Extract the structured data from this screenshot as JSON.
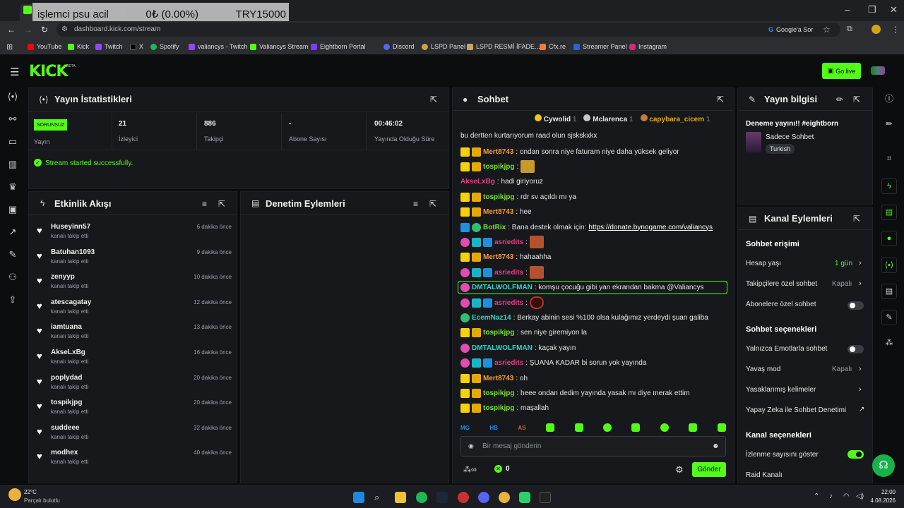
{
  "browser": {
    "ticker": {
      "title": "işlemci psu acil",
      "change": "0₺ (0.00%)",
      "amount": "TRY15000"
    },
    "url": "dashboard.kick.com/stream",
    "ask_google": "Google'a Sor",
    "bookmarks": [
      "YouTube",
      "Kick",
      "Twitch",
      "X",
      "Spotify",
      "valiancys - Twitch",
      "Valiancys Stream",
      "Eightborn Portal",
      "Discord",
      "LSPD Panel",
      "LSPD  RESMİ İFADE...",
      "Cfx.re",
      "Streamer Panel",
      "Instagram"
    ]
  },
  "header": {
    "logo": "KICK",
    "beta": "BETA",
    "go_live": "Go live"
  },
  "stats": {
    "title": "Yayın İstatistikleri",
    "badge": "SORUNSUZ",
    "stream_label": "Yayın",
    "viewers": "21",
    "viewers_label": "İzleyici",
    "followers": "886",
    "followers_label": "Takipçi",
    "subs": "-",
    "subs_label": "Abone Sayısı",
    "uptime": "00:46:02",
    "uptime_label": "Yayında Olduğu Süre",
    "status_msg": "Stream started successfully."
  },
  "activity": {
    "title": "Etkinlik Akışı",
    "items": [
      {
        "name": "Huseyinn57",
        "sub": "kanalı takip etti",
        "time": "6 dakika önce"
      },
      {
        "name": "Batuhan1093",
        "sub": "kanalı takip etti",
        "time": "9 dakika önce"
      },
      {
        "name": "zenyyp",
        "sub": "kanalı takip etti",
        "time": "10 dakika önce"
      },
      {
        "name": "atescagatay",
        "sub": "kanalı takip etti",
        "time": "12 dakika önce"
      },
      {
        "name": "iamtuana",
        "sub": "kanalı takip etti",
        "time": "13 dakika önce"
      },
      {
        "name": "AkseLxBg",
        "sub": "kanalı takip etti",
        "time": "16 dakika önce"
      },
      {
        "name": "poplydad",
        "sub": "kanalı takip etti",
        "time": "20 dakika önce"
      },
      {
        "name": "tospikjpg",
        "sub": "kanalı takip etti",
        "time": "20 dakika önce"
      },
      {
        "name": "suddeee",
        "sub": "kanalı takip etti",
        "time": "32 dakika önce"
      },
      {
        "name": "modhex",
        "sub": "kanalı takip etti",
        "time": "40 dakika önce"
      }
    ]
  },
  "moderation": {
    "title": "Denetim Eylemleri"
  },
  "chat": {
    "title": "Sohbet",
    "top_gifters": [
      {
        "name": "Cywolid",
        "count": "1"
      },
      {
        "name": "Mclarenca",
        "count": "1"
      },
      {
        "name": "capybara_cicem",
        "count": "1"
      }
    ],
    "partial_line": "bu dertten kurtarıyorum raad olun sjskskxkx",
    "messages": [
      {
        "user": "Mert8743",
        "text": ": ondan sonra niye faturam niye daha yüksek geliyor"
      },
      {
        "user": "tospikjpg",
        "text": ":"
      },
      {
        "user": "AkseLxBg",
        "text": ": hadi giriyoruz"
      },
      {
        "user": "tospikjpg",
        "text": ": rdr sv açıldı mı ya"
      },
      {
        "user": "Mert8743",
        "text": ": hee"
      },
      {
        "user": "BotRix",
        "text": ": Bana destek olmak için: ",
        "link": "https://donate.bynogame.com/valiancys"
      },
      {
        "user": "asriedits",
        "text": ":"
      },
      {
        "user": "Mert8743",
        "text": ": hahaahha"
      },
      {
        "user": "asriedits",
        "text": ":"
      },
      {
        "user": "DMTALWOLFMAN",
        "text": ": komşu çocuğu gibi yan ekrandan bakma @Valiancys"
      },
      {
        "user": "asriedits",
        "text": ":"
      },
      {
        "user": "EcemNaz14",
        "text": ": Berkay abinin sesi %100 olsa kulağımız yerdeydi şuan galiba"
      },
      {
        "user": "tospikjpg",
        "text": ": sen niye giremiyon la"
      },
      {
        "user": "DMTALWOLFMAN",
        "text": ": kaçak yayın"
      },
      {
        "user": "asriedits",
        "text": ": ŞUANA KADAR bi sorun yok yayında"
      },
      {
        "user": "Mert8743",
        "text": ": oh"
      },
      {
        "user": "tospikjpg",
        "text": ": heee ondan dedim yayında yasak mı diye merak ettim"
      },
      {
        "user": "tospikjpg",
        "text": ": maşallah"
      }
    ],
    "emote_labels": [
      "MG",
      "HB",
      "AS"
    ],
    "input_placeholder": "Bir mesaj gönderin",
    "points": "0",
    "send": "Gönder"
  },
  "stream_info": {
    "title": "Yayın bilgisi",
    "stream_title": "Deneme yayını!! #eightborn",
    "category": "Sadece Sohbet",
    "language": "Turkish"
  },
  "channel_actions": {
    "title": "Kanal Eylemleri",
    "chat_access": "Sohbet erişimi",
    "account_age": "Hesap yaşı",
    "account_age_val": "1 gün",
    "followers_only": "Takipçilere özel sohbet",
    "followers_only_val": "Kapalı",
    "subs_only": "Abonelere özel sohbet",
    "chat_options": "Sohbet seçenekleri",
    "emote_only": "Yalnızca Emotlarla sohbet",
    "slow_mode": "Yavaş mod",
    "slow_mode_val": "Kapalı",
    "banned_words": "Yasaklanmış kelimeler",
    "ai_mod": "Yapay Zeka ile Sohbet Denetimi",
    "channel_options": "Kanal seçenekleri",
    "show_viewers": "İzlenme sayısını göster",
    "raid": "Raid Kanalı",
    "subs_only_on": false,
    "emote_only_on": false,
    "show_viewers_on": true
  },
  "taskbar": {
    "weather_temp": "22°C",
    "weather_desc": "Parçalı bulutlu",
    "time": "22:00",
    "date": "4.08.2026"
  }
}
